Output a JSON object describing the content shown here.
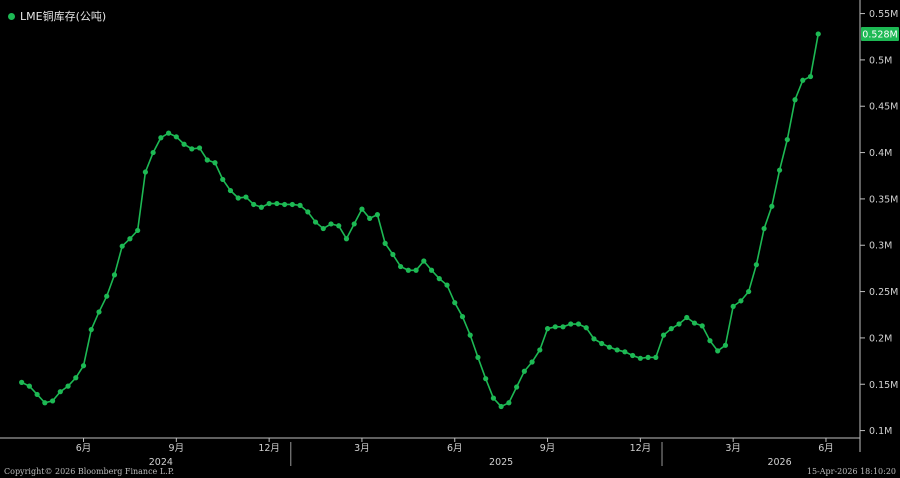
{
  "legend": {
    "label": "LME铜库存(公吨)",
    "color": "#1db954"
  },
  "footer": {
    "copyright": "Copyright© 2026 Bloomberg Finance L.P.",
    "timestamp": "15-Apr-2026 18:10:20"
  },
  "last_value_label": "0.528M",
  "chart_data": {
    "type": "line",
    "series": [
      {
        "name": "LME铜库存(公吨)",
        "color": "#1db954",
        "values": [
          [
            0.0,
            0.152
          ],
          [
            0.25,
            0.148
          ],
          [
            0.5,
            0.139
          ],
          [
            0.75,
            0.13
          ],
          [
            1.0,
            0.132
          ],
          [
            1.25,
            0.142
          ],
          [
            1.5,
            0.148
          ],
          [
            1.75,
            0.157
          ],
          [
            2.0,
            0.17
          ],
          [
            2.25,
            0.209
          ],
          [
            2.5,
            0.228
          ],
          [
            2.75,
            0.245
          ],
          [
            3.0,
            0.268
          ],
          [
            3.25,
            0.299
          ],
          [
            3.5,
            0.307
          ],
          [
            3.75,
            0.316
          ],
          [
            4.0,
            0.379
          ],
          [
            4.25,
            0.4
          ],
          [
            4.5,
            0.416
          ],
          [
            4.75,
            0.421
          ],
          [
            5.0,
            0.417
          ],
          [
            5.25,
            0.409
          ],
          [
            5.5,
            0.404
          ],
          [
            5.75,
            0.405
          ],
          [
            6.0,
            0.392
          ],
          [
            6.25,
            0.389
          ],
          [
            6.5,
            0.371
          ],
          [
            6.75,
            0.359
          ],
          [
            7.0,
            0.351
          ],
          [
            7.25,
            0.352
          ],
          [
            7.5,
            0.344
          ],
          [
            7.75,
            0.341
          ],
          [
            8.0,
            0.345
          ],
          [
            8.25,
            0.345
          ],
          [
            8.5,
            0.344
          ],
          [
            8.75,
            0.344
          ],
          [
            9.0,
            0.343
          ],
          [
            9.25,
            0.336
          ],
          [
            9.5,
            0.325
          ],
          [
            9.75,
            0.318
          ],
          [
            10.0,
            0.323
          ],
          [
            10.25,
            0.321
          ],
          [
            10.5,
            0.307
          ],
          [
            10.75,
            0.323
          ],
          [
            11.0,
            0.339
          ],
          [
            11.25,
            0.329
          ],
          [
            11.5,
            0.333
          ],
          [
            11.75,
            0.302
          ],
          [
            12.0,
            0.29
          ],
          [
            12.25,
            0.277
          ],
          [
            12.5,
            0.273
          ],
          [
            12.75,
            0.273
          ],
          [
            13.0,
            0.283
          ],
          [
            13.25,
            0.273
          ],
          [
            13.5,
            0.264
          ],
          [
            13.75,
            0.257
          ],
          [
            14.0,
            0.238
          ],
          [
            14.25,
            0.223
          ],
          [
            14.5,
            0.203
          ],
          [
            14.75,
            0.179
          ],
          [
            15.0,
            0.156
          ],
          [
            15.25,
            0.135
          ],
          [
            15.5,
            0.126
          ],
          [
            15.75,
            0.13
          ],
          [
            16.0,
            0.147
          ],
          [
            16.25,
            0.164
          ],
          [
            16.5,
            0.174
          ],
          [
            16.75,
            0.187
          ],
          [
            17.0,
            0.21
          ],
          [
            17.25,
            0.212
          ],
          [
            17.5,
            0.212
          ],
          [
            17.75,
            0.215
          ],
          [
            18.0,
            0.215
          ],
          [
            18.25,
            0.211
          ],
          [
            18.5,
            0.199
          ],
          [
            18.75,
            0.194
          ],
          [
            19.0,
            0.19
          ],
          [
            19.25,
            0.187
          ],
          [
            19.5,
            0.185
          ],
          [
            19.75,
            0.181
          ],
          [
            20.0,
            0.178
          ],
          [
            20.25,
            0.179
          ],
          [
            20.5,
            0.179
          ],
          [
            20.75,
            0.203
          ],
          [
            21.0,
            0.21
          ],
          [
            21.25,
            0.215
          ],
          [
            21.5,
            0.222
          ],
          [
            21.75,
            0.216
          ],
          [
            22.0,
            0.213
          ],
          [
            22.25,
            0.197
          ],
          [
            22.5,
            0.186
          ],
          [
            22.75,
            0.192
          ],
          [
            23.0,
            0.234
          ],
          [
            23.25,
            0.24
          ],
          [
            23.5,
            0.25
          ],
          [
            23.75,
            0.279
          ],
          [
            24.0,
            0.318
          ],
          [
            24.25,
            0.342
          ],
          [
            24.5,
            0.381
          ],
          [
            24.75,
            0.414
          ],
          [
            25.0,
            0.457
          ],
          [
            25.25,
            0.478
          ],
          [
            25.5,
            0.482
          ],
          [
            25.75,
            0.528
          ]
        ]
      }
    ],
    "x_start_month": "2024-04",
    "month_ticks": [
      {
        "month": 2,
        "label": "6月"
      },
      {
        "month": 5,
        "label": "9月"
      },
      {
        "month": 8,
        "label": "12月"
      },
      {
        "month": 11,
        "label": "3月"
      },
      {
        "month": 14,
        "label": "6月"
      },
      {
        "month": 17,
        "label": "9月"
      },
      {
        "month": 20,
        "label": "12月"
      },
      {
        "month": 23,
        "label": "3月"
      },
      {
        "month": 26,
        "label": "6月"
      }
    ],
    "year_labels": [
      {
        "month": 4.5,
        "label": "2024"
      },
      {
        "month": 15.5,
        "label": "2025"
      },
      {
        "month": 24.5,
        "label": "2026"
      }
    ],
    "year_separators": [
      8.7,
      20.7
    ],
    "yticks": [
      {
        "v": 0.1,
        "label": "0.1M"
      },
      {
        "v": 0.15,
        "label": "0.15M"
      },
      {
        "v": 0.2,
        "label": "0.2M"
      },
      {
        "v": 0.25,
        "label": "0.25M"
      },
      {
        "v": 0.3,
        "label": "0.3M"
      },
      {
        "v": 0.35,
        "label": "0.35M"
      },
      {
        "v": 0.4,
        "label": "0.4M"
      },
      {
        "v": 0.45,
        "label": "0.45M"
      },
      {
        "v": 0.5,
        "label": "0.5M"
      },
      {
        "v": 0.55,
        "label": "0.55M"
      }
    ],
    "ylim": [
      0.092,
      0.556
    ],
    "xlim": [
      -0.7,
      27.1
    ],
    "grid": false,
    "legend_position": "top-left"
  }
}
